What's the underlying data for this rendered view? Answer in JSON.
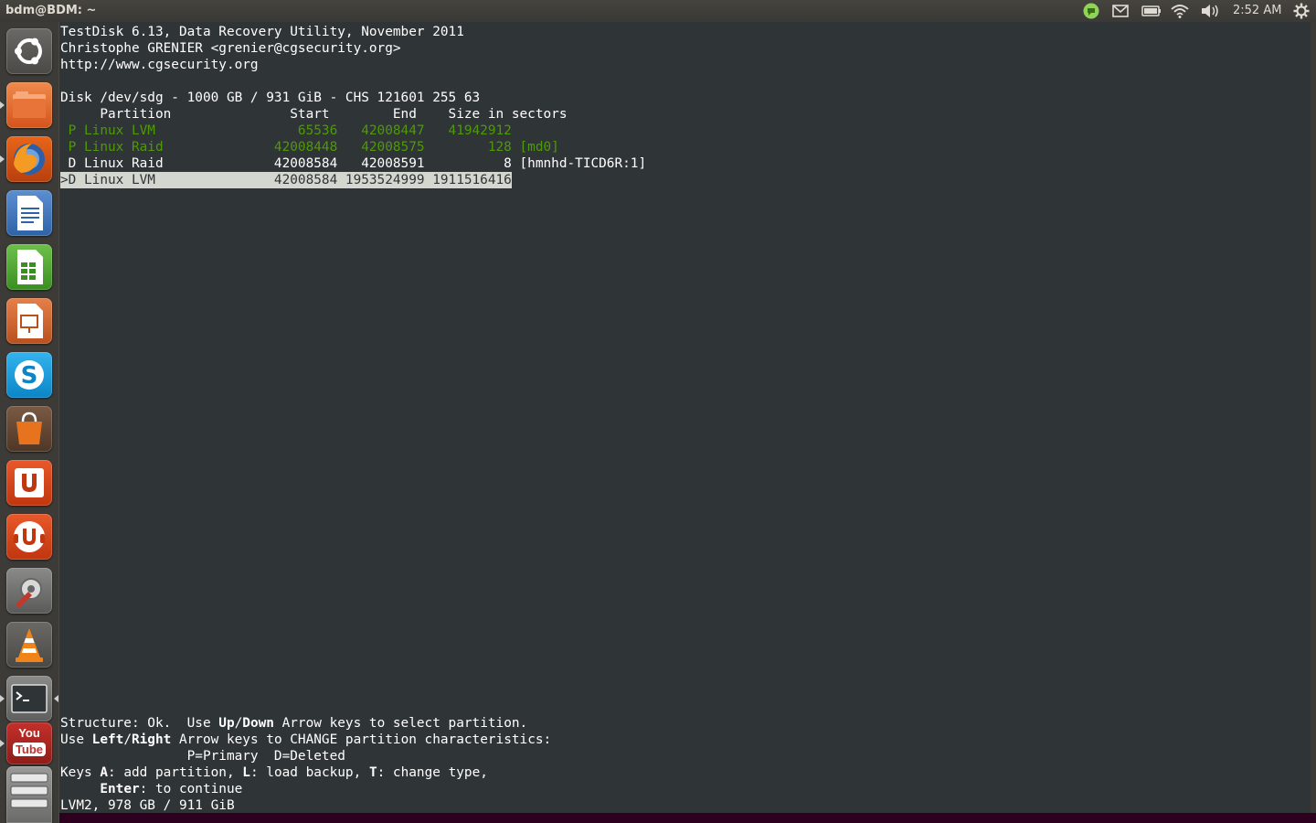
{
  "window": {
    "title": "bdm@BDM: ~"
  },
  "panel": {
    "clock": "2:52 AM",
    "indicators": [
      "chat-indicator",
      "mail-icon",
      "battery-icon",
      "wifi-icon",
      "volume-icon",
      "session-gear-icon"
    ]
  },
  "launcher": {
    "items": [
      {
        "name": "Dash Home",
        "icon": "ubuntu-logo-icon"
      },
      {
        "name": "Home Folder",
        "icon": "folder-icon"
      },
      {
        "name": "Firefox Web Browser",
        "icon": "firefox-icon"
      },
      {
        "name": "LibreOffice Writer",
        "icon": "writer-icon"
      },
      {
        "name": "LibreOffice Calc",
        "icon": "calc-icon"
      },
      {
        "name": "LibreOffice Impress",
        "icon": "impress-icon"
      },
      {
        "name": "Skype",
        "icon": "skype-icon"
      },
      {
        "name": "Ubuntu Software Center",
        "icon": "software-center-icon"
      },
      {
        "name": "Ubuntu One",
        "icon": "ubuntu-one-icon"
      },
      {
        "name": "Ubuntu One Music",
        "icon": "ubuntu-one-music-icon"
      },
      {
        "name": "System Settings",
        "icon": "settings-wrench-icon"
      },
      {
        "name": "VLC media player",
        "icon": "vlc-cone-icon"
      },
      {
        "name": "Terminal",
        "icon": "terminal-icon"
      },
      {
        "name": "YouTube",
        "icon": "youtube-icon",
        "label_top": "You",
        "label_bottom": "Tube"
      },
      {
        "name": "Devices",
        "icon": "drive-icon"
      }
    ]
  },
  "terminal": {
    "header": [
      "TestDisk 6.13, Data Recovery Utility, November 2011",
      "Christophe GRENIER <grenier@cgsecurity.org>",
      "http://www.cgsecurity.org"
    ],
    "disk_line": "Disk /dev/sdg - 1000 GB / 931 GiB - CHS 121601 255 63",
    "table_header": "     Partition               Start        End    Size in sectors",
    "rows": [
      " P Linux LVM                  65536   42008447   41942912",
      " P Linux Raid              42008448   42008575        128 [md0]",
      " D Linux Raid              42008584   42008591          8 [hmnhd-TICD6R:1]",
      ">D Linux LVM               42008584 1953524999 1911516416"
    ],
    "footer": {
      "l1": {
        "a": "Structure: Ok.  Use ",
        "b": "Up",
        "c": "/",
        "d": "Down",
        "e": " Arrow keys to select partition."
      },
      "l2": {
        "a": "Use ",
        "b": "Left",
        "c": "/",
        "d": "Right",
        "e": " Arrow keys to CHANGE partition characteristics:"
      },
      "l3": "                P=Primary  D=Deleted",
      "l4": {
        "a": "Keys ",
        "b": "A",
        "c": ": add partition, ",
        "d": "L",
        "e": ": load backup, ",
        "f": "T",
        "g": ": change type,"
      },
      "l5": {
        "a": "     ",
        "b": "Enter",
        "c": ": to continue"
      },
      "l6": "LVM2, 978 GB / 911 GiB"
    }
  },
  "colors": {
    "terminal_bg": "#2f3436",
    "green": "#4e9a06",
    "selection": "#d3d7cf",
    "panel": "#3c3b37",
    "desktop": "#2c001e"
  }
}
